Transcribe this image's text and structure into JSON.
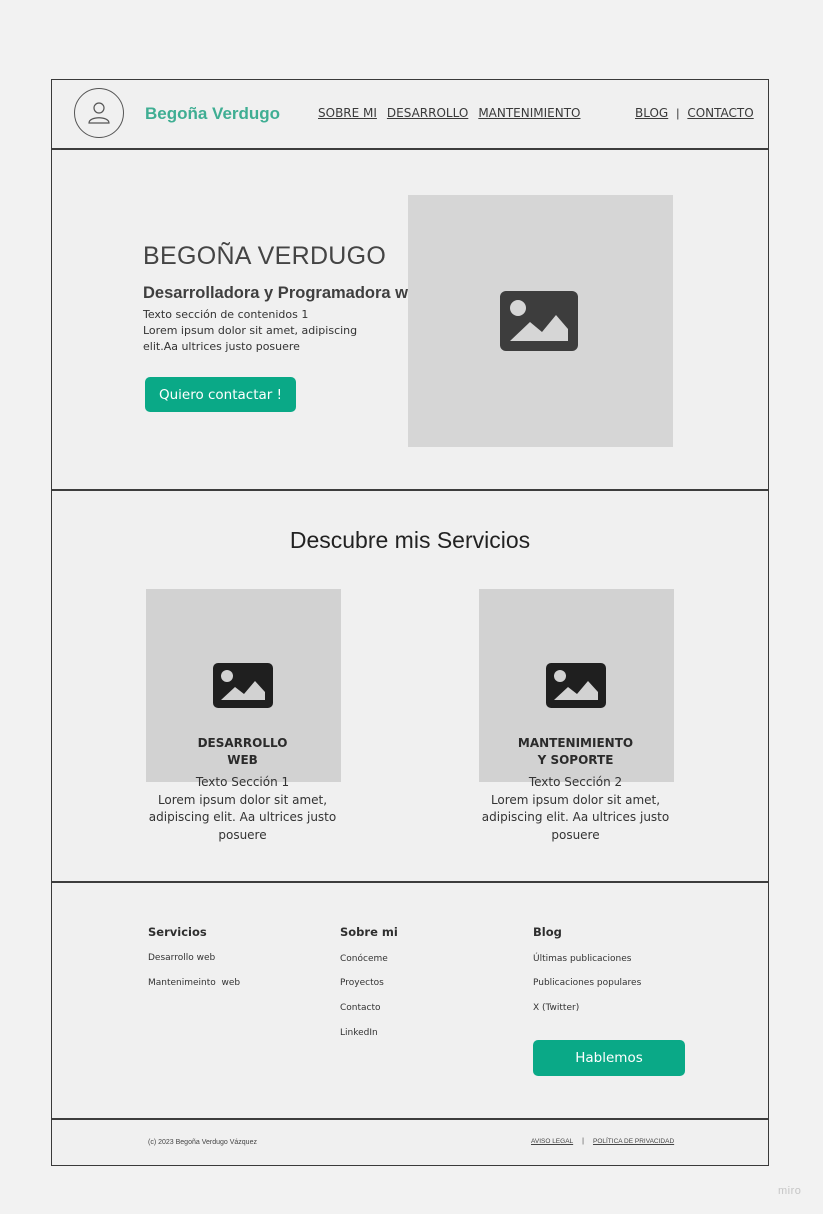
{
  "header": {
    "brand": "Begoña Verdugo",
    "nav": [
      "SOBRE MI",
      "DESARROLLO",
      "MANTENIMIENTO"
    ],
    "nav_right": [
      "BLOG",
      "CONTACTO"
    ],
    "separator": "|"
  },
  "hero": {
    "title": "BEGOÑA VERDUGO",
    "subtitle": "Desarrolladora y Programadora web",
    "text": "Texto sección de contenidos 1\nLorem ipsum dolor sit amet, adipiscing elit.Aa ultrices justo posuere",
    "cta": "Quiero contactar !",
    "image_icon": "image-placeholder-icon"
  },
  "services": {
    "title": "Descubre mis Servicios",
    "cards": [
      {
        "name": "DESARROLLO\nWEB",
        "text": "Texto Sección 1\nLorem ipsum dolor sit amet, adipiscing elit. Aa ultrices justo posuere",
        "icon": "image-placeholder-icon"
      },
      {
        "name": "MANTENIMIENTO\nY SOPORTE",
        "text": "Texto Sección 2\nLorem ipsum dolor sit amet, adipiscing elit. Aa ultrices justo posuere",
        "icon": "image-placeholder-icon"
      }
    ]
  },
  "footer": {
    "columns": [
      {
        "title": "Servicios",
        "links": [
          "Desarrollo web",
          "Mantenimeinto  web"
        ]
      },
      {
        "title": "Sobre mi",
        "links": [
          "Conóceme",
          "Proyectos",
          "Contacto",
          "LinkedIn"
        ]
      },
      {
        "title": "Blog",
        "links": [
          "Últimas publicaciones",
          "Publicaciones populares",
          "X (Twitter)"
        ]
      }
    ],
    "button": "Hablemos"
  },
  "bottom": {
    "copyright": "(c) 2023 Begoña Verdugo Vázquez",
    "legal": [
      "AVISO LEGAL",
      "POLÍTICA DE PRIVACIDAD"
    ],
    "separator": "|"
  },
  "watermark": "miro",
  "colors": {
    "accent": "#0aa987",
    "brand": "#3fae93",
    "placeholder": "#d6d6d6"
  }
}
